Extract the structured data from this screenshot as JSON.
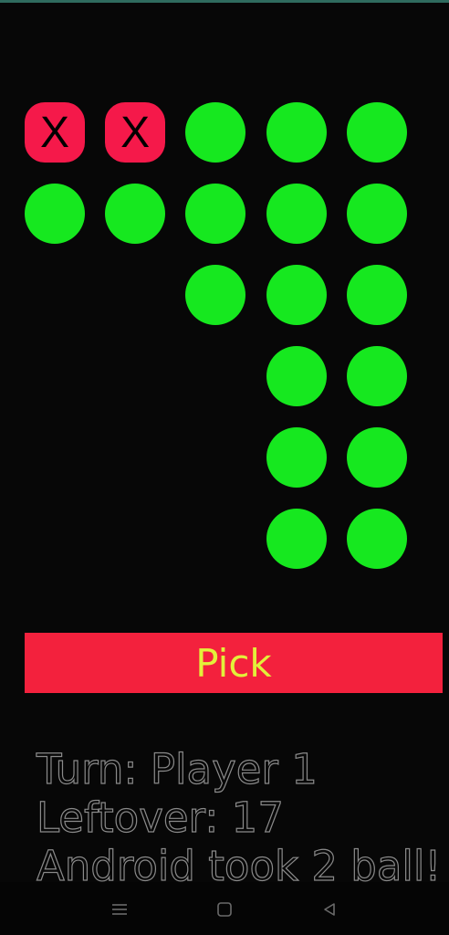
{
  "game": {
    "taken_mark": "X",
    "colors": {
      "background": "#070707",
      "ball_available": "#16e81f",
      "ball_taken": "#f5194a",
      "pick_button": "#f3213d",
      "pick_text": "#e3f03a",
      "status_outline": "#8a8a8a"
    },
    "rows": [
      [
        "taken",
        "taken",
        "available",
        "available",
        "available"
      ],
      [
        "available",
        "available",
        "available",
        "available",
        "available"
      ],
      [
        "empty",
        "empty",
        "available",
        "available",
        "available"
      ],
      [
        "empty",
        "empty",
        "empty",
        "available",
        "available"
      ],
      [
        "empty",
        "empty",
        "empty",
        "available",
        "available"
      ],
      [
        "empty",
        "empty",
        "empty",
        "available",
        "available"
      ]
    ]
  },
  "controls": {
    "pick_label": "Pick"
  },
  "status": {
    "turn": "Turn: Player 1",
    "leftover": "Leftover: 17",
    "message": "Android took 2 ball!"
  },
  "nav": {
    "icons": [
      "menu-icon",
      "home-icon",
      "back-icon"
    ]
  }
}
